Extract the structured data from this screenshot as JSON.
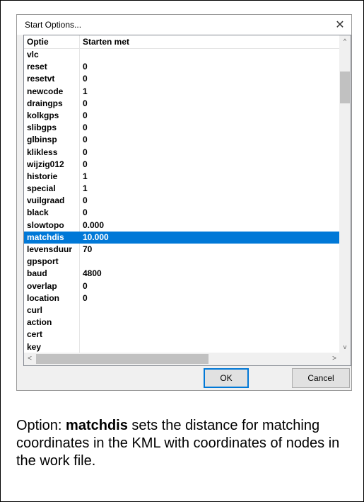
{
  "dialog": {
    "title": "Start Options...",
    "close_glyph": "✕"
  },
  "table": {
    "columns": [
      "Optie",
      "Starten met"
    ],
    "rows": [
      {
        "name": "vlc",
        "value": ""
      },
      {
        "name": "reset",
        "value": "0"
      },
      {
        "name": "resetvt",
        "value": "0"
      },
      {
        "name": "newcode",
        "value": "1"
      },
      {
        "name": "draingps",
        "value": "0"
      },
      {
        "name": "kolkgps",
        "value": "0"
      },
      {
        "name": "slibgps",
        "value": "0"
      },
      {
        "name": "glbinsp",
        "value": "0"
      },
      {
        "name": "klikless",
        "value": "0"
      },
      {
        "name": "wijzig012",
        "value": "0"
      },
      {
        "name": "historie",
        "value": "1"
      },
      {
        "name": "special",
        "value": "1"
      },
      {
        "name": "vuilgraad",
        "value": "0"
      },
      {
        "name": "black",
        "value": "0"
      },
      {
        "name": "slowtopo",
        "value": "0.000"
      },
      {
        "name": "matchdis",
        "value": "10.000",
        "selected": true
      },
      {
        "name": "levensduur",
        "value": "70"
      },
      {
        "name": "gpsport",
        "value": ""
      },
      {
        "name": "baud",
        "value": "4800"
      },
      {
        "name": "overlap",
        "value": "0"
      },
      {
        "name": "location",
        "value": "0"
      },
      {
        "name": "curl",
        "value": ""
      },
      {
        "name": "action",
        "value": ""
      },
      {
        "name": "cert",
        "value": ""
      },
      {
        "name": "key",
        "value": ""
      }
    ]
  },
  "scrollbars": {
    "up_glyph": "^",
    "down_glyph": "v",
    "left_glyph": "<",
    "right_glyph": ">"
  },
  "buttons": {
    "ok": "OK",
    "cancel": "Cancel"
  },
  "caption": {
    "prefix": "Option: ",
    "keyword": "matchdis",
    "suffix": " sets the distance for matching coordinates in the KML with coordinates of nodes in the work file."
  },
  "colors": {
    "selection": "#0078d7",
    "dialog_bg": "#f0f0f0"
  }
}
